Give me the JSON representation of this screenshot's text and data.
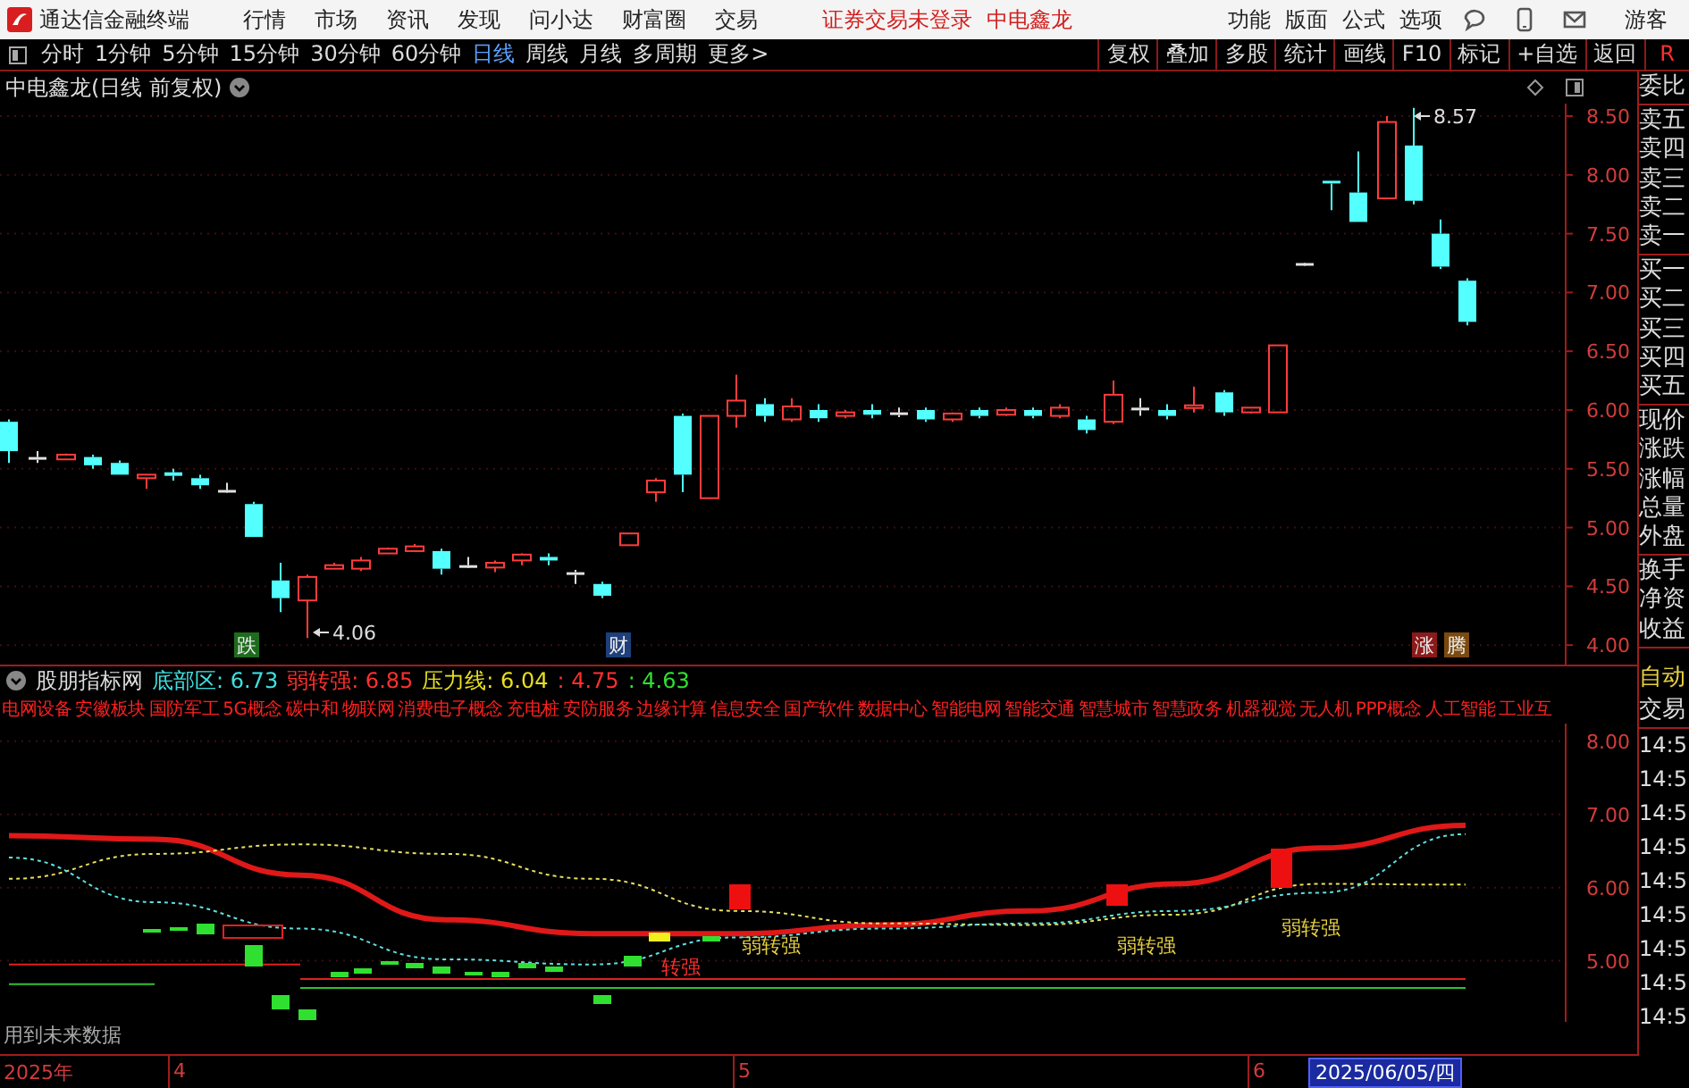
{
  "title_bar": {
    "app_name": "通达信金融终端",
    "menu": [
      "行情",
      "市场",
      "资讯",
      "发现",
      "问小达",
      "财富圈",
      "交易"
    ],
    "notices": [
      "证券交易未登录",
      "中电鑫龙"
    ],
    "tools": [
      "功能",
      "版面",
      "公式",
      "选项"
    ],
    "user": "游客"
  },
  "toolbar": {
    "periods": [
      {
        "label": "分时",
        "selected": false
      },
      {
        "label": "1分钟",
        "selected": false
      },
      {
        "label": "5分钟",
        "selected": false
      },
      {
        "label": "15分钟",
        "selected": false
      },
      {
        "label": "30分钟",
        "selected": false
      },
      {
        "label": "60分钟",
        "selected": false
      },
      {
        "label": "日线",
        "selected": true
      },
      {
        "label": "周线",
        "selected": false
      },
      {
        "label": "月线",
        "selected": false
      },
      {
        "label": "多周期",
        "selected": false
      },
      {
        "label": "更多>",
        "selected": false
      }
    ],
    "actions": [
      "复权",
      "叠加",
      "多股",
      "统计",
      "画线",
      "F10",
      "标记",
      "+自选",
      "返回"
    ],
    "corner": "R"
  },
  "main_chart": {
    "title": "中电鑫龙(日线 前复权)",
    "price_axis": [
      "8.50",
      "8.00",
      "7.50",
      "7.00",
      "6.50",
      "6.00",
      "5.50",
      "5.00",
      "4.50",
      "4.00"
    ],
    "low_label": "4.06",
    "high_label": "8.57",
    "markers": [
      {
        "text": "跌",
        "color": "#1e6b1e"
      },
      {
        "text": "财",
        "color": "#1e3f7a"
      },
      {
        "text": "涨",
        "color": "#8b1a1a"
      },
      {
        "text": "腾",
        "color": "#7a4a10"
      }
    ]
  },
  "indicator": {
    "name": "股朋指标网",
    "values": [
      {
        "text": "底部区: 6.73",
        "color": "#40e0e0"
      },
      {
        "text": "弱转强: 6.85",
        "color": "#ff3030"
      },
      {
        "text": "压力线: 6.04",
        "color": "#e8e020"
      },
      {
        "text": ": 4.75",
        "color": "#ff3030"
      },
      {
        "text": ": 4.63",
        "color": "#30e030"
      }
    ],
    "concepts": [
      "电网设备",
      "安徽板块",
      "国防军工",
      "5G概念",
      "碳中和",
      "物联网",
      "消费电子概念",
      "充电桩",
      "安防服务",
      "边缘计算",
      "信息安全",
      "国产软件",
      "数据中心",
      "智能电网",
      "智能交通",
      "智慧城市",
      "智慧政务",
      "机器视觉",
      "无人机",
      "PPP概念",
      "人工智能",
      "工业互"
    ],
    "chart_data": {
      "type": "line",
      "ylim": [
        4.2,
        8.24
      ],
      "grid": true,
      "yticks": [
        {
          "value": 8,
          "label": "8.00"
        },
        {
          "value": 7,
          "label": "7.00"
        },
        {
          "value": 6,
          "label": "6.00"
        },
        {
          "value": 5,
          "label": "5.00"
        }
      ],
      "series": [
        {
          "color": "#e01818",
          "line_style": "solid",
          "values": [
            6.71,
            6.66,
            6.17,
            5.56,
            5.37,
            5.37,
            5.49,
            5.68,
            6.05,
            6.54,
            6.85
          ]
        },
        {
          "color": "#e8e060",
          "line_style": "dashed",
          "values": [
            6.12,
            6.46,
            6.59,
            6.46,
            6.12,
            5.68,
            5.51,
            5.49,
            5.63,
            6.05,
            6.04
          ]
        },
        {
          "color": "#60e0e0",
          "line_style": "dashed",
          "values": [
            6.41,
            5.8,
            5.44,
            5.02,
            4.95,
            5.32,
            5.44,
            5.51,
            5.68,
            5.93,
            6.73
          ]
        },
        {
          "color": "#e02020",
          "line_style": "solid",
          "values": [
            4.95,
            4.95,
            4.95,
            null,
            null,
            null,
            null,
            null,
            null,
            null,
            null
          ]
        },
        {
          "color": "#30c030",
          "line_style": "solid",
          "values": [
            4.68,
            4.68,
            null,
            null,
            null,
            null,
            null,
            null,
            null,
            null,
            null
          ]
        },
        {
          "color": "#e02020",
          "line_style": "solid",
          "values": [
            null,
            null,
            4.75,
            4.75,
            4.75,
            4.75,
            4.75,
            4.75,
            4.75,
            4.75,
            4.75
          ]
        },
        {
          "color": "#30c030",
          "line_style": "solid",
          "values": [
            null,
            null,
            4.63,
            4.63,
            4.63,
            4.63,
            4.63,
            4.63,
            4.63,
            4.63,
            4.63
          ]
        }
      ]
    },
    "signals": [
      {
        "text": "弱转强",
        "color": "#e8d040"
      },
      {
        "text": "弱转强",
        "color": "#e8d040"
      },
      {
        "text": "弱转强",
        "color": "#e8d040"
      },
      {
        "text": "转强",
        "color": "#ff3030"
      }
    ],
    "note": "用到未来数据"
  },
  "x_axis": {
    "labels": [
      "2025年",
      "4",
      "5",
      "6"
    ],
    "cursor_date": "2025/06/05/四"
  },
  "side_panel": {
    "quote_labels": [
      "委比",
      "卖五",
      "卖四",
      "卖三",
      "卖二",
      "卖一",
      "买一",
      "买二",
      "买三",
      "买四",
      "买五",
      "现价",
      "涨跌",
      "涨幅",
      "总量",
      "外盘",
      "换手",
      "净资",
      "收益"
    ],
    "trade_header": [
      "自动",
      "交易"
    ],
    "times": [
      "14:5",
      "14:5",
      "14:5",
      "14:5",
      "14:5",
      "14:5",
      "14:5",
      "14:5",
      "14:5"
    ]
  }
}
